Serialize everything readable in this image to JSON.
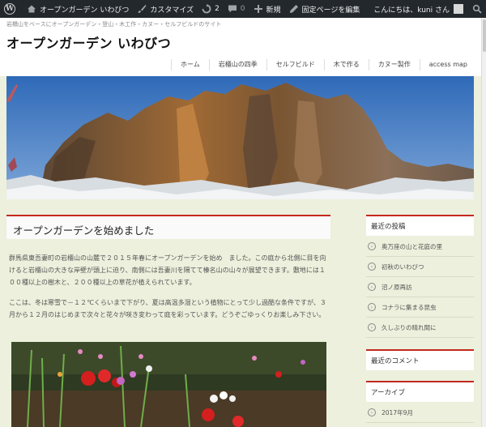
{
  "adminbar": {
    "site_name": "オープンガーデン いわびつ",
    "customize": "カスタマイズ",
    "updates": "2",
    "comments": "0",
    "new": "新規",
    "edit_page": "固定ページを編集",
    "greeting": "こんにちは、kuni さん"
  },
  "header": {
    "tagline": "岩櫃山をベースにオープンガーデン・登山・木工作・カヌー・セルフビルドのサイト",
    "site_title": "オープンガーデン いわびつ"
  },
  "nav": [
    "ホーム",
    "岩櫃山の四季",
    "セルフビルド",
    "木で作る",
    "カヌー製作",
    "access map"
  ],
  "post": {
    "title": "オープンガーデンを始めました",
    "paragraph1": "群馬県東吾妻町の岩櫃山の山麓で２０１５年春にオープンガーデンを始め　ました。この庭から北側に目を向けると岩櫃山の大きな岸壁が頭上に迫り、南側には吾妻川を隔てて榛名山の山々が展望できます。敷地には１００種以上の樹木と、２００種以上の草花が植えられています。",
    "paragraph2": "ここは、冬は寒雪で－１２℃くらいまで下がり、夏は高温多湿という植物にとって少し過酷な条件ですが、３月から１２月のはじめまで次々と花々が咲き変わって庭を彩っています。どうぞごゆっくりお楽しみ下さい。"
  },
  "sidebar": {
    "recent_posts_title": "最近の投稿",
    "recent_posts": [
      "奥万座の山と花庭の里",
      "初秋のいわびつ",
      "沼ノ原再訪",
      "コナラに集まる昆虫",
      "久しぶりの晴れ間に"
    ],
    "recent_comments_title": "最近のコメント",
    "archive_title": "アーカイブ",
    "archives": [
      "2017年9月"
    ]
  },
  "colors": {
    "accent": "#c4281f",
    "adminbar": "#23282d",
    "background": "#ecf0dc"
  }
}
